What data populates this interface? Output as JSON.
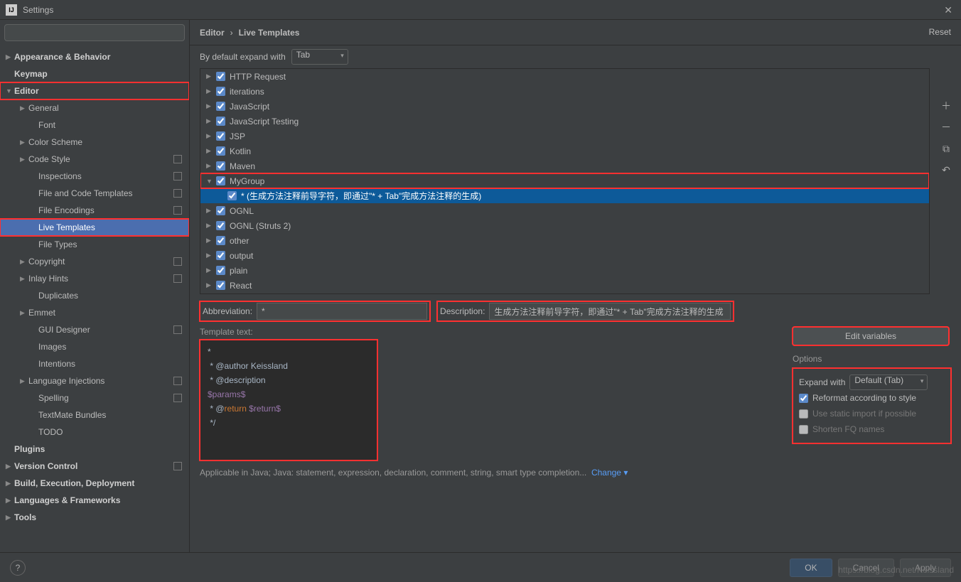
{
  "title": "Settings",
  "search_placeholder": "",
  "breadcrumb": {
    "a": "Editor",
    "sep": "›",
    "b": "Live Templates"
  },
  "reset": "Reset",
  "sidebar": [
    {
      "label": "Appearance & Behavior",
      "bold": true,
      "arrow": "▶",
      "ind": 0
    },
    {
      "label": "Keymap",
      "bold": true,
      "arrow": "",
      "ind": 0
    },
    {
      "label": "Editor",
      "bold": true,
      "arrow": "▼",
      "ind": 0,
      "boxed": true
    },
    {
      "label": "General",
      "arrow": "▶",
      "ind": 1
    },
    {
      "label": "Font",
      "arrow": "",
      "ind": 2
    },
    {
      "label": "Color Scheme",
      "arrow": "▶",
      "ind": 1
    },
    {
      "label": "Code Style",
      "arrow": "▶",
      "ind": 1,
      "badge": true
    },
    {
      "label": "Inspections",
      "arrow": "",
      "ind": 2,
      "badge": true
    },
    {
      "label": "File and Code Templates",
      "arrow": "",
      "ind": 2,
      "badge": true
    },
    {
      "label": "File Encodings",
      "arrow": "",
      "ind": 2,
      "badge": true
    },
    {
      "label": "Live Templates",
      "arrow": "",
      "ind": 2,
      "sel": true,
      "boxed": true
    },
    {
      "label": "File Types",
      "arrow": "",
      "ind": 2
    },
    {
      "label": "Copyright",
      "arrow": "▶",
      "ind": 1,
      "badge": true
    },
    {
      "label": "Inlay Hints",
      "arrow": "▶",
      "ind": 1,
      "badge": true
    },
    {
      "label": "Duplicates",
      "arrow": "",
      "ind": 2
    },
    {
      "label": "Emmet",
      "arrow": "▶",
      "ind": 1
    },
    {
      "label": "GUI Designer",
      "arrow": "",
      "ind": 2,
      "badge": true
    },
    {
      "label": "Images",
      "arrow": "",
      "ind": 2
    },
    {
      "label": "Intentions",
      "arrow": "",
      "ind": 2
    },
    {
      "label": "Language Injections",
      "arrow": "▶",
      "ind": 1,
      "badge": true
    },
    {
      "label": "Spelling",
      "arrow": "",
      "ind": 2,
      "badge": true
    },
    {
      "label": "TextMate Bundles",
      "arrow": "",
      "ind": 2
    },
    {
      "label": "TODO",
      "arrow": "",
      "ind": 2
    },
    {
      "label": "Plugins",
      "bold": true,
      "arrow": "",
      "ind": 0
    },
    {
      "label": "Version Control",
      "bold": true,
      "arrow": "▶",
      "ind": 0,
      "badge": true
    },
    {
      "label": "Build, Execution, Deployment",
      "bold": true,
      "arrow": "▶",
      "ind": 0
    },
    {
      "label": "Languages & Frameworks",
      "bold": true,
      "arrow": "▶",
      "ind": 0
    },
    {
      "label": "Tools",
      "bold": true,
      "arrow": "▶",
      "ind": 0
    }
  ],
  "expand_label": "By default expand with",
  "expand_value": "Tab",
  "tree": [
    {
      "label": "HTTP Request",
      "arrow": "▶"
    },
    {
      "label": "iterations",
      "arrow": "▶"
    },
    {
      "label": "JavaScript",
      "arrow": "▶"
    },
    {
      "label": "JavaScript Testing",
      "arrow": "▶"
    },
    {
      "label": "JSP",
      "arrow": "▶"
    },
    {
      "label": "Kotlin",
      "arrow": "▶"
    },
    {
      "label": "Maven",
      "arrow": "▶"
    },
    {
      "label": "MyGroup",
      "arrow": "▼",
      "boxed": true
    },
    {
      "label": "* (生成方法注释前导字符，即通过\"* + Tab\"完成方法注释的生成)",
      "sub": true,
      "sel": true
    },
    {
      "label": "OGNL",
      "arrow": "▶"
    },
    {
      "label": "OGNL (Struts 2)",
      "arrow": "▶"
    },
    {
      "label": "other",
      "arrow": "▶"
    },
    {
      "label": "output",
      "arrow": "▶"
    },
    {
      "label": "plain",
      "arrow": "▶"
    },
    {
      "label": "React",
      "arrow": "▶"
    }
  ],
  "abbr_label": "Abbreviation:",
  "abbr_value": "*",
  "desc_label": "Description:",
  "desc_value": "生成方法注释前导字符，即通过\"* + Tab\"完成方法注释的生成",
  "tmpl_label": "Template text:",
  "tmpl_lines": [
    {
      "t": "*"
    },
    {
      "t": " * @author Keissland"
    },
    {
      "t": " * @description"
    },
    {
      "t": "$params$",
      "cls": "kw-purple"
    },
    {
      "p1": " * @",
      "kw": "return",
      "p2": " ",
      "var": "$return$"
    },
    {
      "t": " */"
    }
  ],
  "edit_vars": "Edit variables",
  "options_title": "Options",
  "expand_with_label": "Expand with",
  "expand_with_value": "Default (Tab)",
  "opt1": "Reformat according to style",
  "opt2": "Use static import if possible",
  "opt3": "Shorten FQ names",
  "applicable": "Applicable in Java; Java: statement, expression, declaration, comment, string, smart type completion...",
  "change": "Change",
  "ok": "OK",
  "cancel": "Cancel",
  "apply": "Apply",
  "watermark": "https://blog.csdn.net/Keissland"
}
